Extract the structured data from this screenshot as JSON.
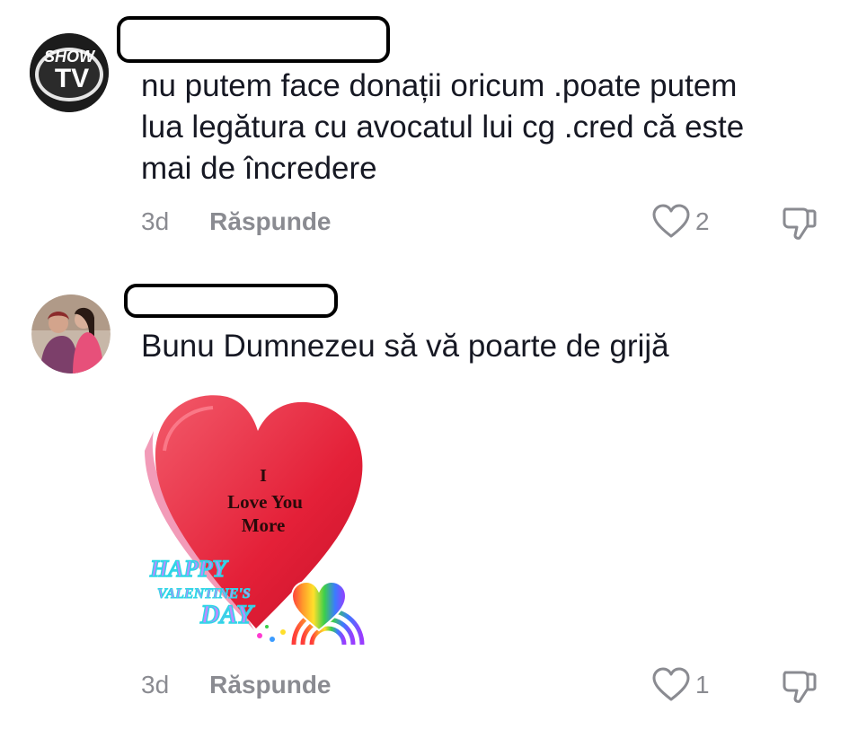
{
  "comments": [
    {
      "avatar_logo": {
        "line1": "SHOW",
        "line2": "TV"
      },
      "text_lines": [
        "nu putem face donații oricum .poate putem",
        "lua legătura cu avocatul lui cg .cred că este",
        "mai de încredere"
      ],
      "time": "3d",
      "reply_label": "Răspunde",
      "like_count": "2"
    },
    {
      "text_lines": [
        "Bunu Dumnezeu să vă poarte de grijă"
      ],
      "gif": {
        "heart_text_1": "I",
        "heart_text_2": "Love You",
        "heart_text_3": "More",
        "banner_1": "HAPPY",
        "banner_2": "VALENTINE'S",
        "banner_3": "DAY"
      },
      "time": "3d",
      "reply_label": "Răspunde",
      "like_count": "1"
    }
  ],
  "colors": {
    "text": "#161823",
    "muted": "#8a8b91",
    "heart_red": "#e8283c"
  },
  "icons": [
    "heart-outline-icon",
    "thumbs-down-icon"
  ]
}
